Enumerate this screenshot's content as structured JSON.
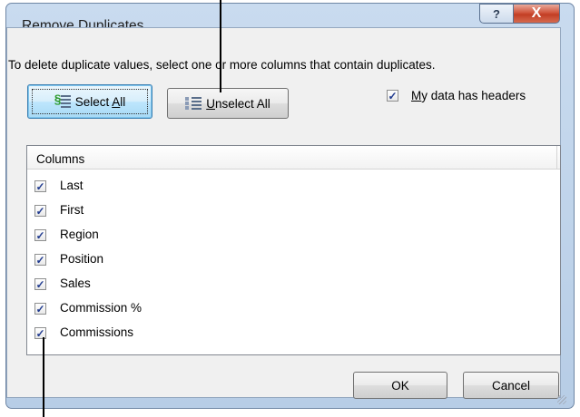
{
  "dialog": {
    "title": "Remove Duplicates",
    "help_glyph": "?",
    "close_glyph": "X",
    "instruction": "To delete duplicate values, select one or more columns that contain duplicates.",
    "select_all_label": "Select All",
    "select_all_underline": "A",
    "unselect_all_label": "Unselect All",
    "unselect_all_underline": "U",
    "headers_checkbox": {
      "label": "My data has headers",
      "underline": "M",
      "checked": true
    },
    "columns_header": "Columns",
    "columns": [
      {
        "label": "Last",
        "checked": true
      },
      {
        "label": "First",
        "checked": true
      },
      {
        "label": "Region",
        "checked": true
      },
      {
        "label": "Position",
        "checked": true
      },
      {
        "label": "Sales",
        "checked": true
      },
      {
        "label": "Commission %",
        "checked": true
      },
      {
        "label": "Commissions",
        "checked": true
      }
    ],
    "ok_label": "OK",
    "cancel_label": "Cancel",
    "check_glyph": "✓"
  }
}
